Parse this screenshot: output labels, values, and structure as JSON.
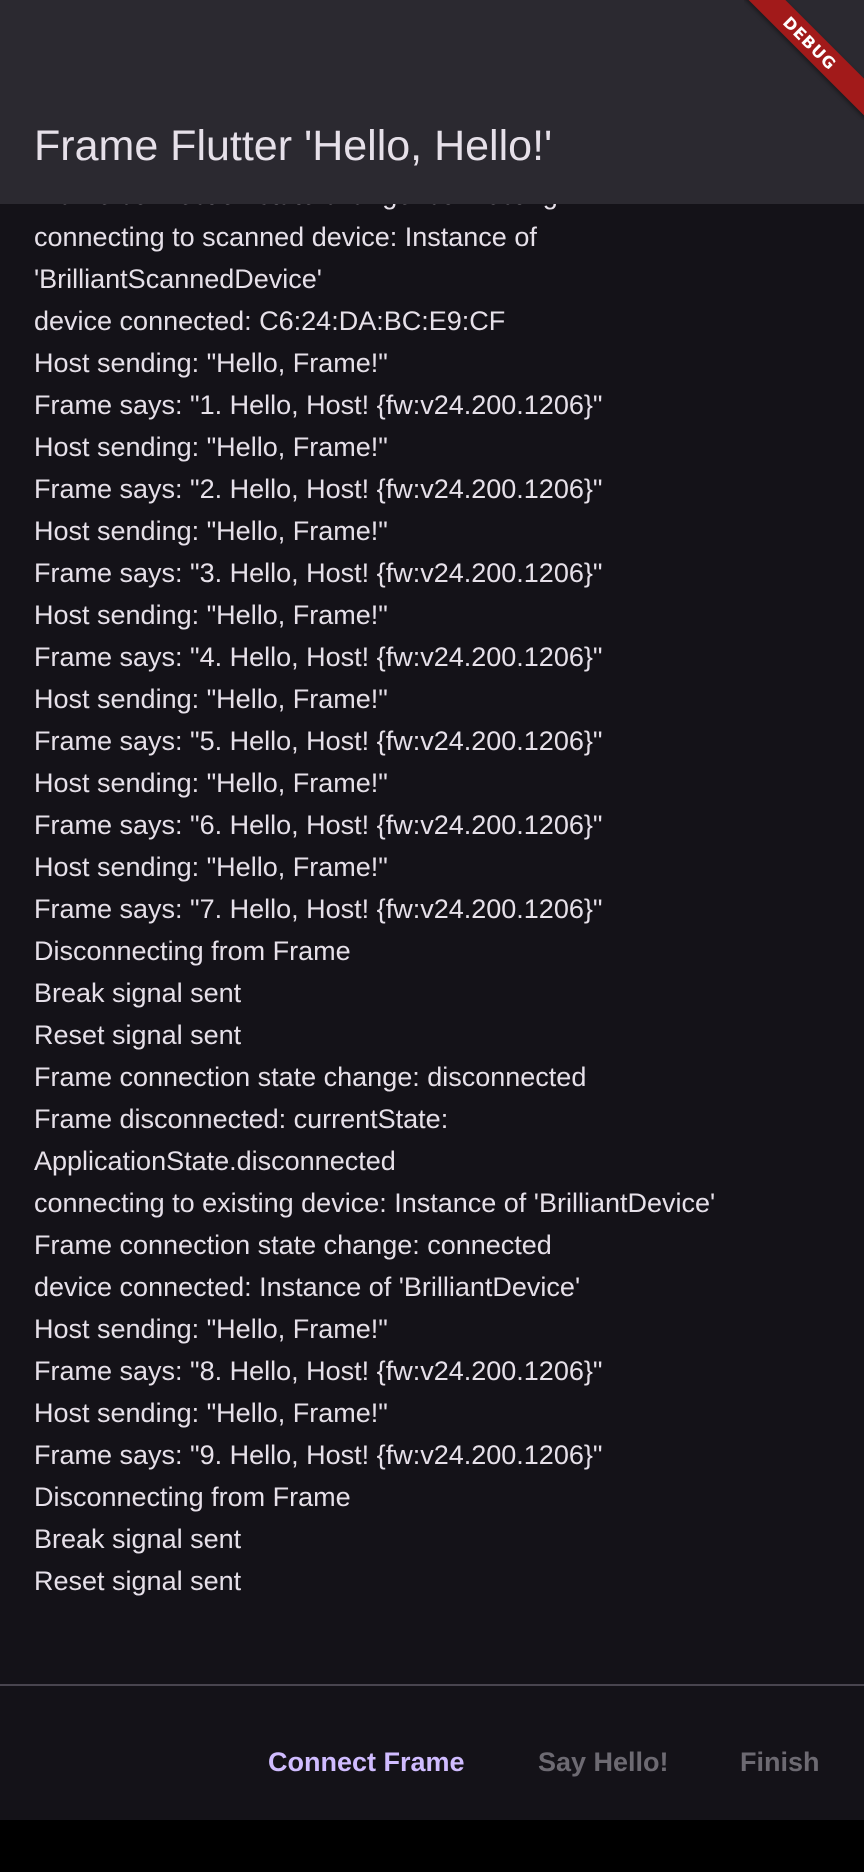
{
  "app_bar": {
    "title": "Frame Flutter 'Hello, Hello!'",
    "debug_banner": "DEBUG"
  },
  "log": [
    "Frame connection state change: connecting",
    "connecting to scanned device: Instance of",
    "'BrilliantScannedDevice'",
    "device connected: C6:24:DA:BC:E9:CF",
    "Host sending: \"Hello, Frame!\"",
    "Frame says: \"1. Hello, Host! {fw:v24.200.1206}\"",
    "Host sending: \"Hello, Frame!\"",
    "Frame says: \"2. Hello, Host! {fw:v24.200.1206}\"",
    "Host sending: \"Hello, Frame!\"",
    "Frame says: \"3. Hello, Host! {fw:v24.200.1206}\"",
    "Host sending: \"Hello, Frame!\"",
    "Frame says: \"4. Hello, Host! {fw:v24.200.1206}\"",
    "Host sending: \"Hello, Frame!\"",
    "Frame says: \"5. Hello, Host! {fw:v24.200.1206}\"",
    "Host sending: \"Hello, Frame!\"",
    "Frame says: \"6. Hello, Host! {fw:v24.200.1206}\"",
    "Host sending: \"Hello, Frame!\"",
    "Frame says: \"7. Hello, Host! {fw:v24.200.1206}\"",
    "Disconnecting from Frame",
    "Break signal sent",
    "Reset signal sent",
    "Frame connection state change: disconnected",
    "Frame disconnected: currentState:",
    "ApplicationState.disconnected",
    "connecting to existing device: Instance of 'BrilliantDevice'",
    "Frame connection state change: connected",
    "device connected: Instance of 'BrilliantDevice'",
    "Host sending: \"Hello, Frame!\"",
    "Frame says: \"8. Hello, Host! {fw:v24.200.1206}\"",
    "Host sending: \"Hello, Frame!\"",
    "Frame says: \"9. Hello, Host! {fw:v24.200.1206}\"",
    "Disconnecting from Frame",
    "Break signal sent",
    "Reset signal sent"
  ],
  "actions": {
    "connect_label": "Connect Frame",
    "say_hello_label": "Say Hello!",
    "finish_label": "Finish"
  },
  "colors": {
    "primary": "#d0bcff",
    "disabled": "#6d6a72",
    "surface": "#141218",
    "app_bar": "#2b2930"
  }
}
